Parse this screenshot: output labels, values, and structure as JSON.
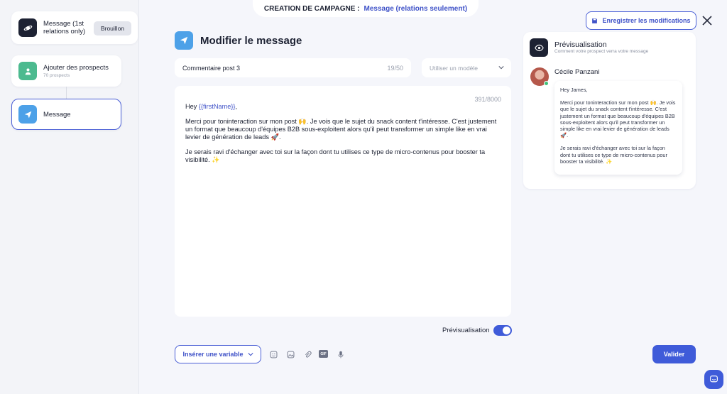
{
  "topbar": {
    "label": "CREATION DE CAMPAGNE :",
    "value": "Message (relations seulement)"
  },
  "sidebar": {
    "campaign": {
      "title_line1": "Message (1st",
      "title_line2": "relations only)",
      "badge": "Brouillon"
    },
    "steps": [
      {
        "label": "Ajouter des prospects",
        "sub": "70 prospects"
      },
      {
        "label": "Message"
      }
    ]
  },
  "header": {
    "save_label": "Enregistrer les modifications"
  },
  "editor": {
    "title": "Modifier le message",
    "comment_value": "Commentaire post 3",
    "comment_counter": "19/50",
    "template_placeholder": "Utiliser un modèle",
    "char_counter": "391/8000",
    "greeting": "Hey ",
    "variable": "{{firstName}}",
    "greeting_end": ",",
    "paragraph1": "Merci pour toninteraction sur mon post 🙌. Je vois que le sujet du snack content t'intéresse. C'est justement un format que beaucoup d'équipes B2B sous-exploitent alors qu'il peut transformer un simple like en vrai levier de génération de leads 🚀.",
    "paragraph2": "Je serais ravi d'échanger avec toi sur la façon dont tu utilises ce type de micro-contenus pour booster ta visibilité. ✨",
    "preview_toggle_label": "Prévisualisation",
    "insert_variable_label": "Insérer une variable",
    "gif_label": "GIF",
    "submit_label": "Valider"
  },
  "preview": {
    "title": "Prévisualisation",
    "subtitle": "Comment votre prospect verra votre message",
    "name": "Cécile Panzani",
    "greeting": "Hey James,",
    "paragraph1": "Merci pour toninteraction sur mon post 🙌. Je vois que le sujet du snack content t'intéresse. C'est justement un format que beaucoup d'équipes B2B sous-exploitent alors qu'il peut transformer un simple like en vrai levier de génération de leads 🚀.",
    "paragraph2": "Je serais ravi d'échanger avec toi sur la façon dont tu utilises ce type de micro-contenus pour booster ta visibilité. ✨"
  },
  "colors": {
    "accent": "#3f5bd9",
    "green": "#4cba8f",
    "dark": "#1d2233"
  }
}
